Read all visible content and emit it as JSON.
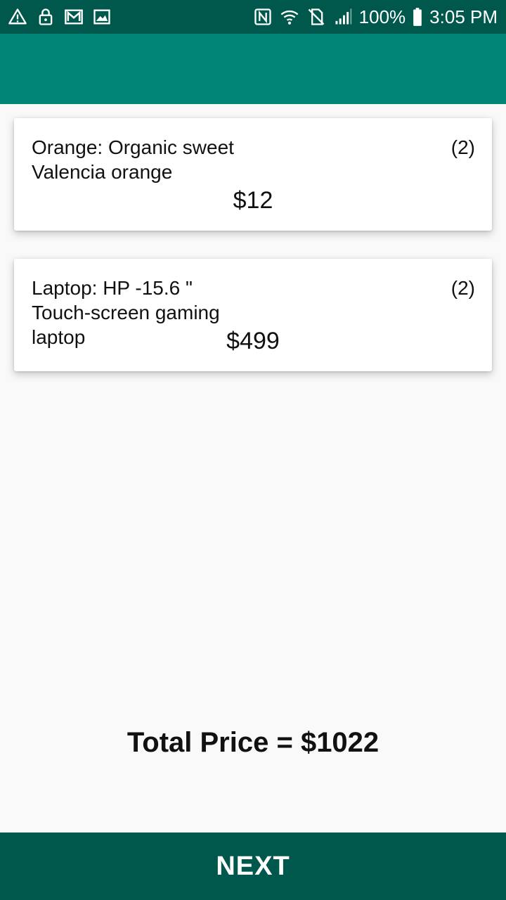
{
  "status_bar": {
    "battery": "100%",
    "time": "3:05 PM",
    "icons_left": [
      "warning-icon",
      "lock-icon",
      "gmail-icon",
      "image-icon"
    ],
    "icons_right": [
      "nfc-icon",
      "wifi-icon",
      "no-sim-icon",
      "signal-icon",
      "battery-icon"
    ]
  },
  "cart": {
    "items": [
      {
        "name": "Orange: Organic sweet Valencia orange",
        "qty": "(2)",
        "price": "$12"
      },
      {
        "name": "Laptop: HP -15.6 \" Touch-screen gaming laptop",
        "qty": "(2)",
        "price": "$499"
      }
    ]
  },
  "total": {
    "label": "Total Price = $1022"
  },
  "next_button": {
    "label": "NEXT"
  },
  "colors": {
    "status_bar": "#00574b",
    "app_bar": "#008577",
    "button": "#00574b",
    "background": "#f9f9f9"
  }
}
